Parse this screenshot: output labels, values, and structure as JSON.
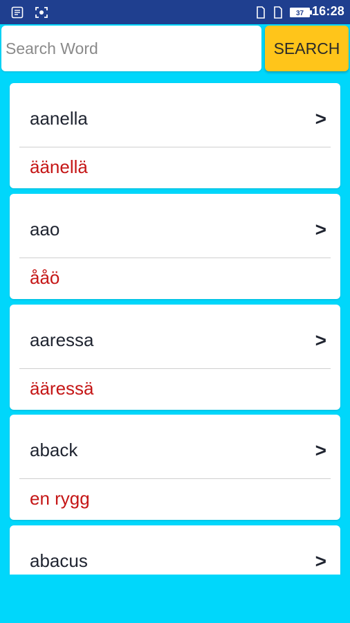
{
  "status": {
    "time": "16:28",
    "battery": "37",
    "icons": [
      "notes-icon",
      "screenshot-icon",
      "sim1-icon",
      "sim2-icon",
      "battery-icon"
    ]
  },
  "search": {
    "placeholder": "Search Word",
    "value": "",
    "button_label": "SEARCH"
  },
  "colors": {
    "statusbar": "#1f3f8f",
    "background": "#00d7fb",
    "search_button": "#ffc51a",
    "translation": "#c51616"
  },
  "entries": [
    {
      "word": "aanella",
      "translation": "äänellä",
      "chevron": ">"
    },
    {
      "word": "aao",
      "translation": "ååö",
      "chevron": ">"
    },
    {
      "word": "aaressa",
      "translation": "ääressä",
      "chevron": ">"
    },
    {
      "word": "aback",
      "translation": "en rygg",
      "chevron": ">"
    },
    {
      "word": "abacus",
      "translation": "",
      "chevron": ">"
    }
  ]
}
